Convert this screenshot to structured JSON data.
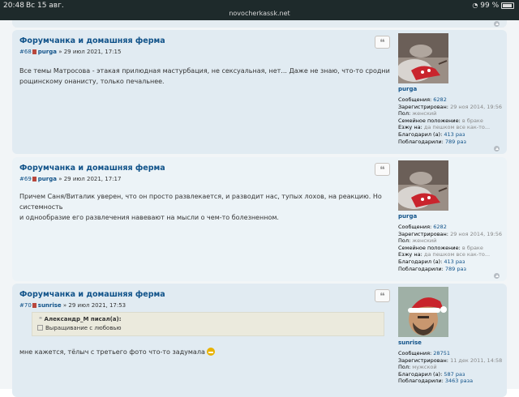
{
  "status_bar": {
    "time": "20:48",
    "date": "Вс 15 авг.",
    "url": "novocherkassk.net",
    "battery": "99 %"
  },
  "posts": [
    {
      "title": "Форумчанка и домашняя ферма",
      "number": "#68",
      "author": "purga",
      "datetime": "» 29 июл 2021, 17:15",
      "content": [
        "Все темы Матросова - этакая прилюдная мастурбация, не сексуальная, нет... Даже не знаю, что-то сродни",
        "рощинскому онанисту, только печальнее."
      ],
      "profile": {
        "username": "purga",
        "fields": [
          {
            "label": "Сообщения:",
            "value": "6282",
            "link": true
          },
          {
            "label": "Зарегистрирован:",
            "value": "29 ноя 2014, 19:56",
            "link": false
          },
          {
            "label": "Пол:",
            "value": "женский",
            "link": false
          },
          {
            "label": "Семейное положение:",
            "value": "в браке",
            "link": false
          },
          {
            "label": "Езжу на:",
            "value": "да пешком все как-то...",
            "link": false
          },
          {
            "label": "Благодарил (а):",
            "value": "413 раз",
            "link": true
          },
          {
            "label": "Поблагодарили:",
            "value": "789 раз",
            "link": true
          }
        ]
      }
    },
    {
      "title": "Форумчанка и домашняя ферма",
      "number": "#69",
      "author": "purga",
      "datetime": "» 29 июл 2021, 17:17",
      "content": [
        "Причем Саня/Виталик уверен, что он просто развлекается, и разводит нас, тупых лохов, на реакцию. Но системность",
        "и однообразие его развлечения навевают на мысли о чем-то болезненном."
      ],
      "profile": {
        "username": "purga",
        "fields": [
          {
            "label": "Сообщения:",
            "value": "6282",
            "link": true
          },
          {
            "label": "Зарегистрирован:",
            "value": "29 ноя 2014, 19:56",
            "link": false
          },
          {
            "label": "Пол:",
            "value": "женский",
            "link": false
          },
          {
            "label": "Семейное положение:",
            "value": "в браке",
            "link": false
          },
          {
            "label": "Езжу на:",
            "value": "да пешком все как-то...",
            "link": false
          },
          {
            "label": "Благодарил (а):",
            "value": "413 раз",
            "link": true
          },
          {
            "label": "Поблагодарили:",
            "value": "789 раз",
            "link": true
          }
        ]
      }
    },
    {
      "title": "Форумчанка и домашняя ферма",
      "number": "#70",
      "author": "sunrise",
      "datetime": "» 29 июл 2021, 17:53",
      "quote": {
        "author": "Александр_М писал(а):",
        "text": "Выращивание с любовью"
      },
      "content": [
        "мне кажется, тёлыч с третьего фото что-то задумала"
      ],
      "profile": {
        "username": "sunrise",
        "fields": [
          {
            "label": "Сообщения:",
            "value": "28751",
            "link": true
          },
          {
            "label": "Зарегистрирован:",
            "value": "11 дек 2011, 14:58",
            "link": false
          },
          {
            "label": "Пол:",
            "value": "мужской",
            "link": false
          },
          {
            "label": "Благодарил (а):",
            "value": "587 раз",
            "link": true
          },
          {
            "label": "Поблагодарили:",
            "value": "3463 раза",
            "link": true
          }
        ]
      }
    }
  ],
  "icons": {
    "quote_button": "quote-icon",
    "back_to_top": "arrow-up-circle-icon",
    "post_link": "document-icon",
    "emoji": "grin-emoji-icon"
  },
  "colors": {
    "link": "#105289",
    "post_bg_odd": "#e1ebf2",
    "post_bg_even": "#ecf3f7",
    "status_bar": "#1e2a2b"
  }
}
